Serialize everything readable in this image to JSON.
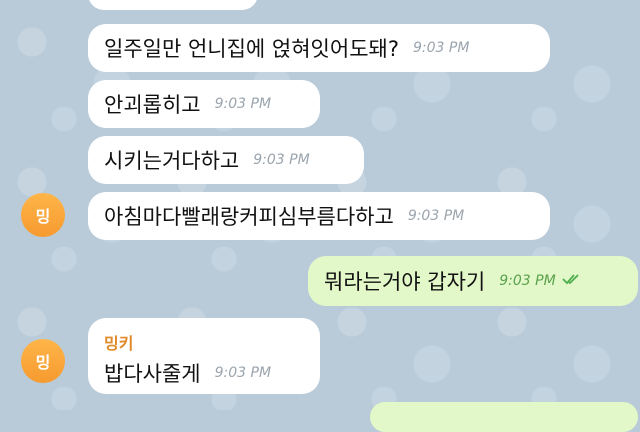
{
  "chat": {
    "messages": [
      {
        "text": "일주일만 언니집에 얹혀잇어도돼?",
        "time": "9:03 PM"
      },
      {
        "text": "안괴롭히고",
        "time": "9:03 PM"
      },
      {
        "text": "시키는거다하고",
        "time": "9:03 PM"
      },
      {
        "text": "아침마다빨래랑커피심부름다하고",
        "time": "9:03 PM"
      },
      {
        "text": "뭐라는거야 갑자기",
        "time": "9:03 PM"
      },
      {
        "text": "밥다사줄게",
        "time": "9:03 PM",
        "sender": "밍키"
      }
    ],
    "avatar_initial": "밍"
  },
  "colors": {
    "background": "#b9cbd9",
    "incoming_bubble": "#ffffff",
    "outgoing_bubble": "#e3f8c8",
    "avatar": "#f69a2f",
    "sender_name": "#e08a2b"
  },
  "icons": {
    "read_receipt": "double-check-icon"
  }
}
